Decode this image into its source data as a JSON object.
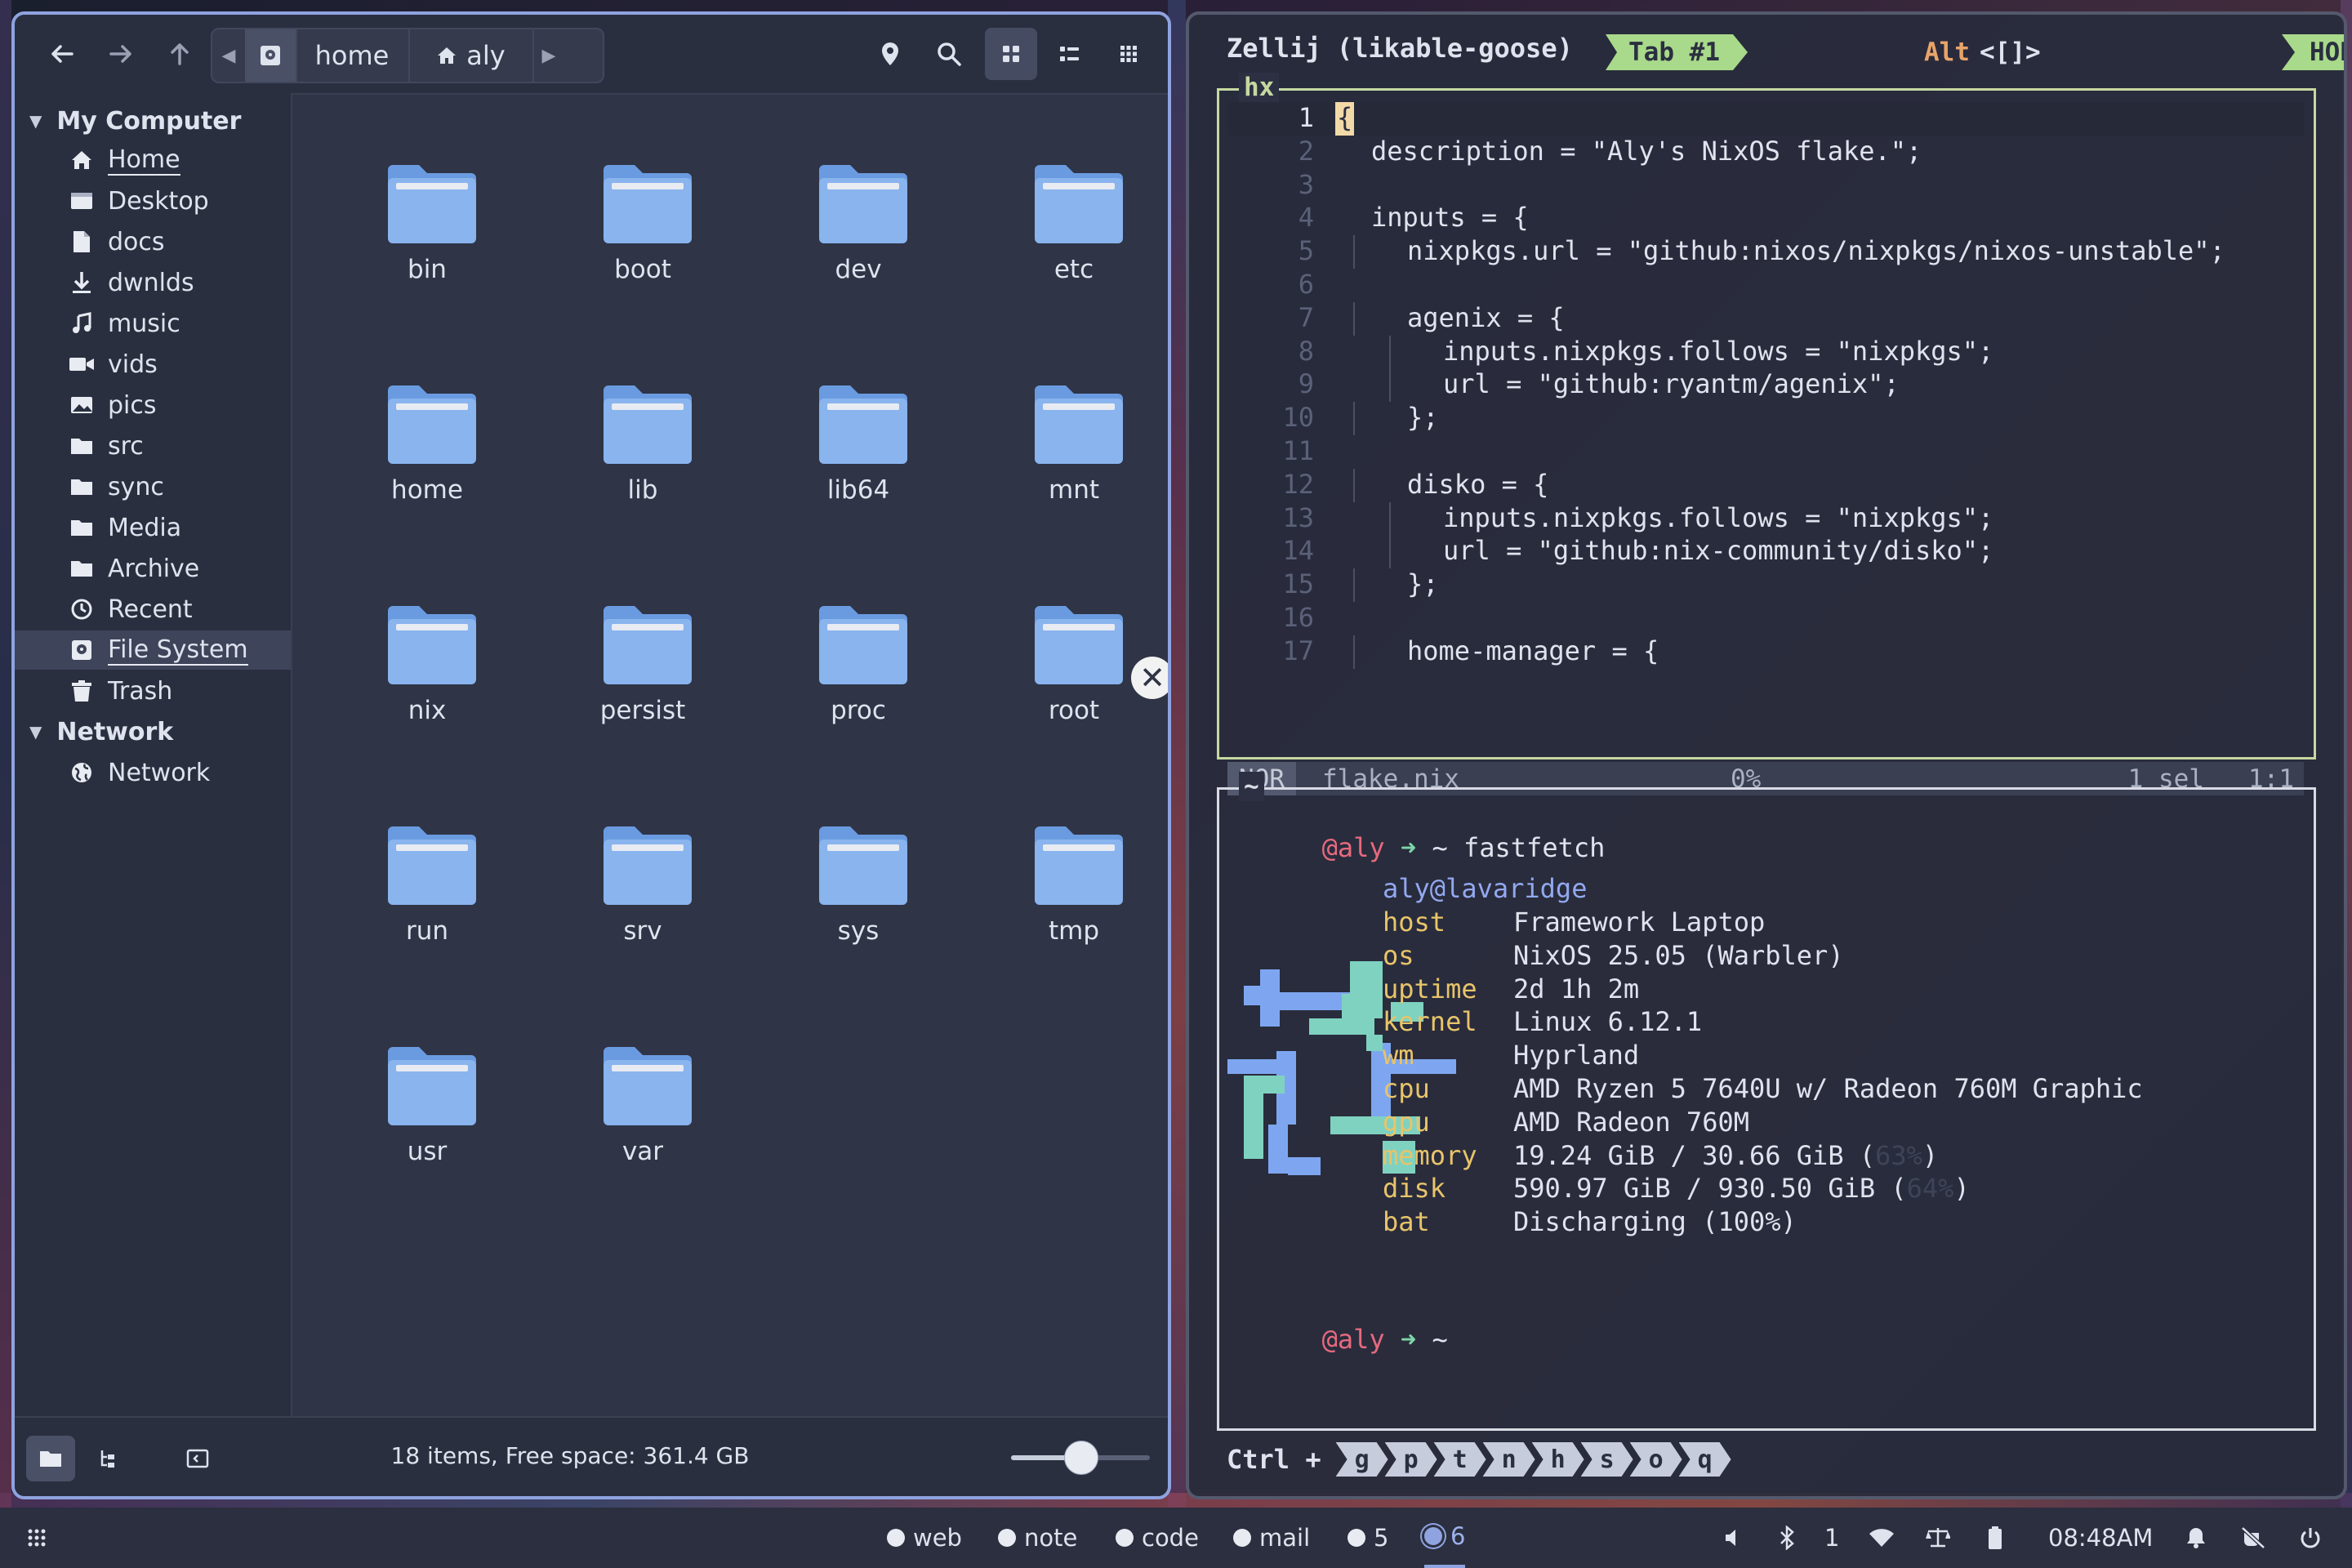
{
  "file_manager": {
    "toolbar": {
      "back_icon": "arrow-left-icon",
      "forward_icon": "arrow-right-icon",
      "up_icon": "arrow-up-icon",
      "path": [
        {
          "label": "",
          "icon": "drive-icon"
        },
        {
          "label": "home",
          "icon": ""
        },
        {
          "label": "aly",
          "icon": "home-icon"
        }
      ]
    },
    "sidebar": {
      "sections": [
        {
          "title": "My Computer",
          "items": [
            {
              "label": "Home",
              "icon": "home-icon"
            },
            {
              "label": "Desktop",
              "icon": "desktop-icon"
            },
            {
              "label": "docs",
              "icon": "document-icon"
            },
            {
              "label": "dwnlds",
              "icon": "download-icon"
            },
            {
              "label": "music",
              "icon": "music-icon"
            },
            {
              "label": "vids",
              "icon": "video-icon"
            },
            {
              "label": "pics",
              "icon": "image-icon"
            },
            {
              "label": "src",
              "icon": "folder-icon"
            },
            {
              "label": "sync",
              "icon": "folder-icon"
            },
            {
              "label": "Media",
              "icon": "folder-icon"
            },
            {
              "label": "Archive",
              "icon": "folder-icon"
            },
            {
              "label": "Recent",
              "icon": "clock-icon"
            },
            {
              "label": "File System",
              "icon": "drive-icon"
            },
            {
              "label": "Trash",
              "icon": "trash-icon"
            }
          ]
        },
        {
          "title": "Network",
          "items": [
            {
              "label": "Network",
              "icon": "globe-icon"
            }
          ]
        }
      ]
    },
    "folders": [
      "bin",
      "boot",
      "dev",
      "etc",
      "home",
      "lib",
      "lib64",
      "mnt",
      "nix",
      "persist",
      "proc",
      "root",
      "run",
      "srv",
      "sys",
      "tmp",
      "usr",
      "var"
    ],
    "status": {
      "text": "18 items, Free space: 361.4 GB",
      "zoom_fraction": 0.5
    }
  },
  "zellij": {
    "title": "Zellij (likable-goose)",
    "tab": "Tab #1",
    "alt_label": "Alt",
    "alt_hint": "<[]>",
    "mode": "HORIZONTAL",
    "editor": {
      "pane_title": "hx",
      "lines": [
        {
          "n": "1",
          "text": "{"
        },
        {
          "n": "2",
          "text": "description = \"Aly's NixOS flake.\";"
        },
        {
          "n": "3",
          "text": ""
        },
        {
          "n": "4",
          "text": "inputs = {"
        },
        {
          "n": "5",
          "text": "nixpkgs.url = \"github:nixos/nixpkgs/nixos-unstable\";"
        },
        {
          "n": "6",
          "text": ""
        },
        {
          "n": "7",
          "text": "agenix = {"
        },
        {
          "n": "8",
          "text": "inputs.nixpkgs.follows = \"nixpkgs\";"
        },
        {
          "n": "9",
          "text": "url = \"github:ryantm/agenix\";"
        },
        {
          "n": "10",
          "text": "};"
        },
        {
          "n": "11",
          "text": ""
        },
        {
          "n": "12",
          "text": "disko = {"
        },
        {
          "n": "13",
          "text": "inputs.nixpkgs.follows = \"nixpkgs\";"
        },
        {
          "n": "14",
          "text": "url = \"github:nix-community/disko\";"
        },
        {
          "n": "15",
          "text": "};"
        },
        {
          "n": "16",
          "text": ""
        },
        {
          "n": "17",
          "text": "home-manager = {"
        }
      ],
      "status": {
        "mode": "NOR",
        "file": "flake.nix",
        "percent": "0%",
        "sel": "1 sel",
        "pos": "1:1"
      }
    },
    "shell": {
      "pane_title": "~",
      "user": "@aly",
      "arrow": "➜",
      "cwd": "~",
      "command": "fastfetch",
      "fetch_title": "aly@lavaridge",
      "fetch": [
        {
          "key": "host",
          "val": "Framework Laptop"
        },
        {
          "key": "os",
          "val": "NixOS 25.05 (Warbler)"
        },
        {
          "key": "uptime",
          "val": "2d 1h 2m"
        },
        {
          "key": "kernel",
          "val": "Linux 6.12.1"
        },
        {
          "key": "wm",
          "val": "Hyprland"
        },
        {
          "key": "cpu",
          "val": "AMD Ryzen 5 7640U w/ Radeon 760M Graphic"
        },
        {
          "key": "gpu",
          "val": "AMD Radeon 760M"
        },
        {
          "key": "memory",
          "val": "19.24 GiB / 30.66 GiB (",
          "dim": "63%",
          "end": ")"
        },
        {
          "key": "disk",
          "val": "590.97 GiB / 930.50 GiB (",
          "dim": "64%",
          "end": ")"
        },
        {
          "key": "bat",
          "val": "Discharging (100%)"
        }
      ]
    },
    "keybar": {
      "ctrl": "Ctrl +",
      "keys": [
        "g",
        "p",
        "t",
        "n",
        "h",
        "s",
        "o",
        "q"
      ]
    }
  },
  "taskbar": {
    "workspaces": [
      {
        "label": "web"
      },
      {
        "label": "note"
      },
      {
        "label": "code"
      },
      {
        "label": "mail"
      },
      {
        "label": "5"
      },
      {
        "label": "6",
        "active": true
      }
    ],
    "bluetooth_count": "1",
    "clock": "08:48AM"
  }
}
